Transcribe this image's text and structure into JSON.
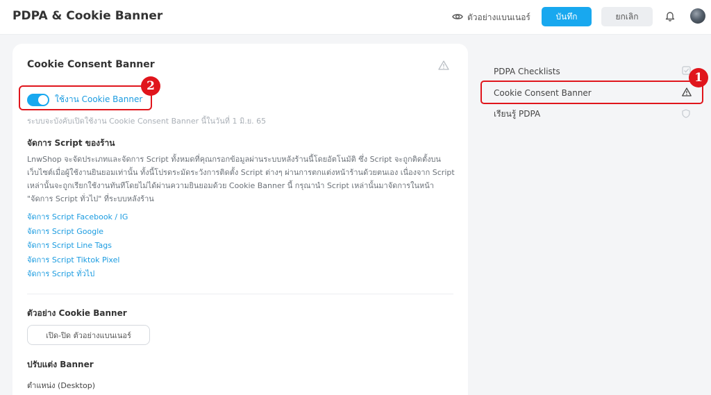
{
  "header": {
    "title": "PDPA & Cookie Banner",
    "preview_label": "ตัวอย่างแบนเนอร์",
    "save_label": "บันทึก",
    "cancel_label": "ยกเลิก"
  },
  "main": {
    "card_title": "Cookie Consent Banner",
    "toggle": {
      "label": "ใช้งาน Cookie Banner",
      "enabled": true
    },
    "hint": "ระบบจะบังคับเปิดใช้งาน Cookie Consent Banner นี้ในวันที่ 1 มิ.ย. 65",
    "script_section": {
      "heading": "จัดการ Script ของร้าน",
      "description": "LnwShop จะจัดประเภทและจัดการ Script ทั้งหมดที่คุณกรอกข้อมูลผ่านระบบหลังร้านนี้โดยอัตโนมัติ ซึ่ง Script จะถูกติดตั้งบนเว็บไซต์เมื่อผู้ใช้งานยินยอมเท่านั้น ทั้งนี้โปรดระมัดระวังการติดตั้ง Script ต่างๆ ผ่านการตกแต่งหน้าร้านด้วยตนเอง เนื่องจาก Script เหล่านั้นจะถูกเรียกใช้งานทันทีโดยไม่ได้ผ่านความยินยอมด้วย Cookie Banner นี้ กรุณานำ Script เหล่านั้นมาจัดการในหน้า \"จัดการ Script ทั่วไป\" ที่ระบบหลังร้าน",
      "links": [
        "จัดการ Script Facebook / IG",
        "จัดการ Script Google",
        "จัดการ Script Line Tags",
        "จัดการ Script Tiktok Pixel",
        "จัดการ Script ทั่วไป"
      ]
    },
    "preview_section": {
      "heading": "ตัวอย่าง Cookie Banner",
      "button_label": "เปิด-ปิด ตัวอย่างแบนเนอร์"
    },
    "customize_section": {
      "heading": "ปรับแต่ง Banner",
      "position_label": "ตำแหน่ง (Desktop)"
    }
  },
  "sidebar": {
    "items": [
      {
        "label": "PDPA Checklists",
        "icon": "checkbox-icon"
      },
      {
        "label": "Cookie Consent Banner",
        "icon": "warning-icon"
      },
      {
        "label": "เรียนรู้ PDPA",
        "icon": "shield-icon"
      }
    ]
  },
  "annotations": {
    "badge_1": "1",
    "badge_2": "2"
  },
  "colors": {
    "accent": "#18a8ef",
    "annotation": "#e0151c"
  }
}
